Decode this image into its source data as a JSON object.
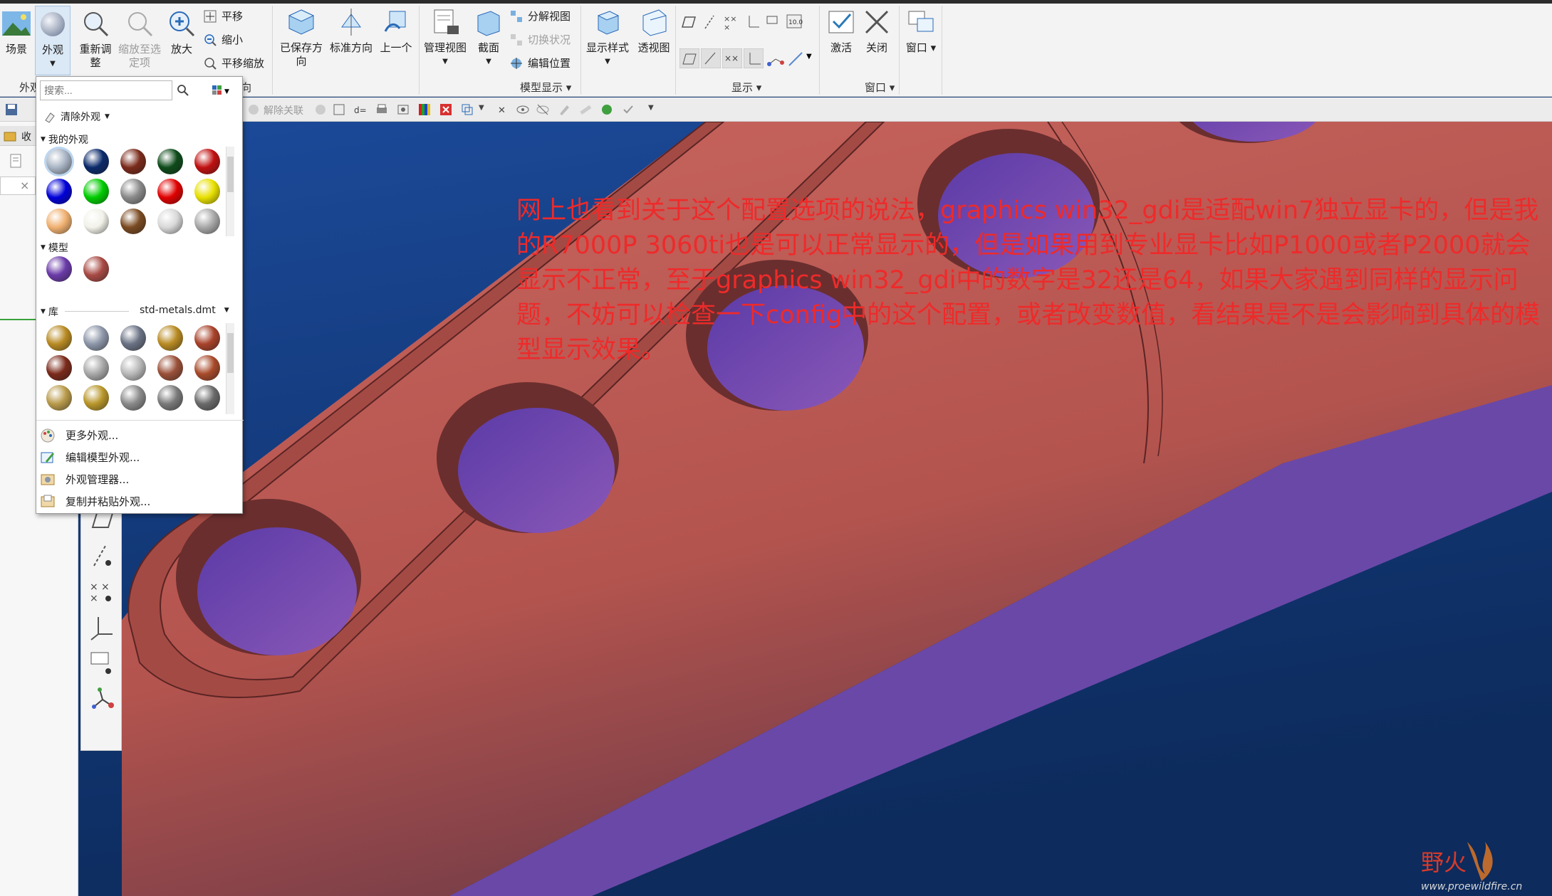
{
  "ribbon": {
    "scene_label": "场景",
    "appearance_label": "外观",
    "refit_label": "重新调整",
    "zoom_to_selected_label": "缩放至选定项",
    "zoom_in_label": "放大",
    "pan_label": "平移",
    "zoom_out_label": "缩小",
    "pan_zoom_label": "平移缩放",
    "saved_orient_label": "已保存方向",
    "standard_orient_label": "标准方向",
    "previous_label": "上一个",
    "manage_views_label": "管理视图",
    "section_label": "截面",
    "explode_view_label": "分解视图",
    "toggle_status_label": "切换状况",
    "edit_position_label": "编辑位置",
    "display_style_label": "显示样式",
    "perspective_label": "透视图",
    "activate_label": "激活",
    "close_label": "关闭",
    "window_label": "窗口",
    "group_appearance": "外观",
    "group_orientation_tail": "向",
    "group_model_display": "模型显示",
    "group_show": "显示",
    "group_window": "窗口"
  },
  "strip": {
    "unlink_label": "解除关联"
  },
  "left_panel": {
    "tab_label": "收"
  },
  "appearance_dropdown": {
    "search_placeholder": "搜索...",
    "clear_appearance": "清除外观",
    "my_appearances_label": "我的外观",
    "model_label": "模型",
    "library_label": "库",
    "library_file": "std-metals.dmt",
    "my_swatches": [
      "#a8b4c4",
      "#0a2a6a",
      "#7a2a1a",
      "#0d4a1a",
      "#c01010",
      "#0000d8",
      "#00cc00",
      "#8a8a8a",
      "#e00000",
      "#e8e000",
      "#f0b070",
      "#f2f2ea",
      "#7a4a22",
      "#d8d8d8",
      "#a8a8a8"
    ],
    "model_swatches": [
      "#6a3aa8",
      "#a84a44"
    ],
    "library_swatches": [
      "#b88a22",
      "#8c96a8",
      "#6a7284",
      "#b88a22",
      "#a8422a",
      "#7a2a1a",
      "#a8a8a8",
      "#b8b8b8",
      "#9a5038",
      "#a84a2a",
      "#b89a4a",
      "#b8962a",
      "#8a8a8a",
      "#7a7a7a",
      "#6a6a6a"
    ],
    "more_appearances": "更多外观...",
    "edit_model_appearance": "编辑模型外观...",
    "appearance_manager": "外观管理器...",
    "copy_paste_appearance": "复制并粘贴外观..."
  },
  "overlay_text": "网上也看到关于这个配置选项的说法，graphics win32_gdi是适配win7独立显卡的，但是我的R7000P 3060ti也是可以正常显示的，但是如果用到专业显卡比如P1000或者P2000就会显示不正常，至于graphics win32_gdi中的数字是32还是64，如果大家遇到同样的显示问题，不妨可以检查一下config中的这个配置，或者改变数值，看结果是不是会影响到具体的模型显示效果。",
  "watermark": {
    "text": "野火",
    "url": "www.proewildfire.cn"
  }
}
